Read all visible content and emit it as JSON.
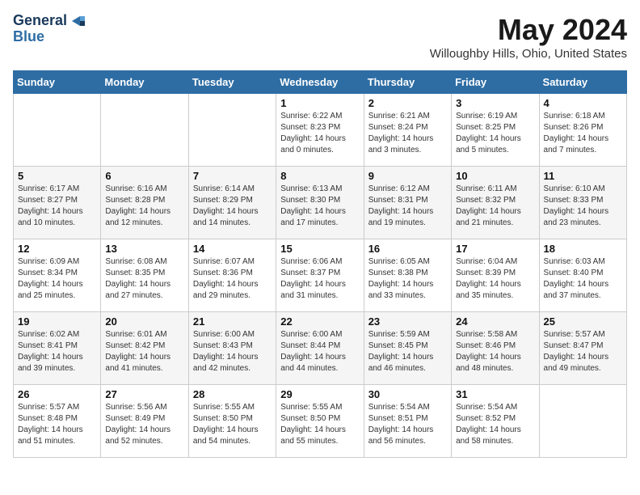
{
  "logo": {
    "line1": "General",
    "line2": "Blue"
  },
  "title": "May 2024",
  "location": "Willoughby Hills, Ohio, United States",
  "days_of_week": [
    "Sunday",
    "Monday",
    "Tuesday",
    "Wednesday",
    "Thursday",
    "Friday",
    "Saturday"
  ],
  "weeks": [
    [
      {
        "day": "",
        "content": ""
      },
      {
        "day": "",
        "content": ""
      },
      {
        "day": "",
        "content": ""
      },
      {
        "day": "1",
        "content": "Sunrise: 6:22 AM\nSunset: 8:23 PM\nDaylight: 14 hours\nand 0 minutes."
      },
      {
        "day": "2",
        "content": "Sunrise: 6:21 AM\nSunset: 8:24 PM\nDaylight: 14 hours\nand 3 minutes."
      },
      {
        "day": "3",
        "content": "Sunrise: 6:19 AM\nSunset: 8:25 PM\nDaylight: 14 hours\nand 5 minutes."
      },
      {
        "day": "4",
        "content": "Sunrise: 6:18 AM\nSunset: 8:26 PM\nDaylight: 14 hours\nand 7 minutes."
      }
    ],
    [
      {
        "day": "5",
        "content": "Sunrise: 6:17 AM\nSunset: 8:27 PM\nDaylight: 14 hours\nand 10 minutes."
      },
      {
        "day": "6",
        "content": "Sunrise: 6:16 AM\nSunset: 8:28 PM\nDaylight: 14 hours\nand 12 minutes."
      },
      {
        "day": "7",
        "content": "Sunrise: 6:14 AM\nSunset: 8:29 PM\nDaylight: 14 hours\nand 14 minutes."
      },
      {
        "day": "8",
        "content": "Sunrise: 6:13 AM\nSunset: 8:30 PM\nDaylight: 14 hours\nand 17 minutes."
      },
      {
        "day": "9",
        "content": "Sunrise: 6:12 AM\nSunset: 8:31 PM\nDaylight: 14 hours\nand 19 minutes."
      },
      {
        "day": "10",
        "content": "Sunrise: 6:11 AM\nSunset: 8:32 PM\nDaylight: 14 hours\nand 21 minutes."
      },
      {
        "day": "11",
        "content": "Sunrise: 6:10 AM\nSunset: 8:33 PM\nDaylight: 14 hours\nand 23 minutes."
      }
    ],
    [
      {
        "day": "12",
        "content": "Sunrise: 6:09 AM\nSunset: 8:34 PM\nDaylight: 14 hours\nand 25 minutes."
      },
      {
        "day": "13",
        "content": "Sunrise: 6:08 AM\nSunset: 8:35 PM\nDaylight: 14 hours\nand 27 minutes."
      },
      {
        "day": "14",
        "content": "Sunrise: 6:07 AM\nSunset: 8:36 PM\nDaylight: 14 hours\nand 29 minutes."
      },
      {
        "day": "15",
        "content": "Sunrise: 6:06 AM\nSunset: 8:37 PM\nDaylight: 14 hours\nand 31 minutes."
      },
      {
        "day": "16",
        "content": "Sunrise: 6:05 AM\nSunset: 8:38 PM\nDaylight: 14 hours\nand 33 minutes."
      },
      {
        "day": "17",
        "content": "Sunrise: 6:04 AM\nSunset: 8:39 PM\nDaylight: 14 hours\nand 35 minutes."
      },
      {
        "day": "18",
        "content": "Sunrise: 6:03 AM\nSunset: 8:40 PM\nDaylight: 14 hours\nand 37 minutes."
      }
    ],
    [
      {
        "day": "19",
        "content": "Sunrise: 6:02 AM\nSunset: 8:41 PM\nDaylight: 14 hours\nand 39 minutes."
      },
      {
        "day": "20",
        "content": "Sunrise: 6:01 AM\nSunset: 8:42 PM\nDaylight: 14 hours\nand 41 minutes."
      },
      {
        "day": "21",
        "content": "Sunrise: 6:00 AM\nSunset: 8:43 PM\nDaylight: 14 hours\nand 42 minutes."
      },
      {
        "day": "22",
        "content": "Sunrise: 6:00 AM\nSunset: 8:44 PM\nDaylight: 14 hours\nand 44 minutes."
      },
      {
        "day": "23",
        "content": "Sunrise: 5:59 AM\nSunset: 8:45 PM\nDaylight: 14 hours\nand 46 minutes."
      },
      {
        "day": "24",
        "content": "Sunrise: 5:58 AM\nSunset: 8:46 PM\nDaylight: 14 hours\nand 48 minutes."
      },
      {
        "day": "25",
        "content": "Sunrise: 5:57 AM\nSunset: 8:47 PM\nDaylight: 14 hours\nand 49 minutes."
      }
    ],
    [
      {
        "day": "26",
        "content": "Sunrise: 5:57 AM\nSunset: 8:48 PM\nDaylight: 14 hours\nand 51 minutes."
      },
      {
        "day": "27",
        "content": "Sunrise: 5:56 AM\nSunset: 8:49 PM\nDaylight: 14 hours\nand 52 minutes."
      },
      {
        "day": "28",
        "content": "Sunrise: 5:55 AM\nSunset: 8:50 PM\nDaylight: 14 hours\nand 54 minutes."
      },
      {
        "day": "29",
        "content": "Sunrise: 5:55 AM\nSunset: 8:50 PM\nDaylight: 14 hours\nand 55 minutes."
      },
      {
        "day": "30",
        "content": "Sunrise: 5:54 AM\nSunset: 8:51 PM\nDaylight: 14 hours\nand 56 minutes."
      },
      {
        "day": "31",
        "content": "Sunrise: 5:54 AM\nSunset: 8:52 PM\nDaylight: 14 hours\nand 58 minutes."
      },
      {
        "day": "",
        "content": ""
      }
    ]
  ]
}
